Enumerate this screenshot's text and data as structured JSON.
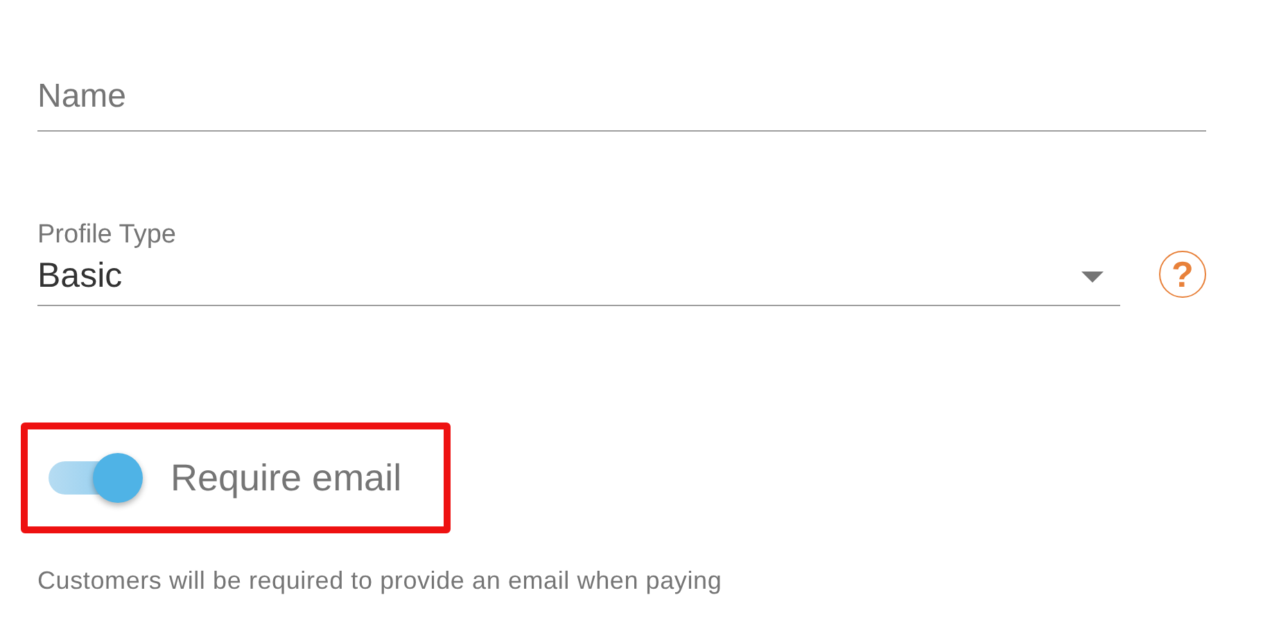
{
  "name_field": {
    "placeholder": "Name"
  },
  "profile_type": {
    "label": "Profile Type",
    "value": "Basic",
    "help": "?"
  },
  "require_email": {
    "label": "Require email",
    "on": true,
    "highlighted": true
  },
  "hint": "Customers will be required to provide an email when paying"
}
